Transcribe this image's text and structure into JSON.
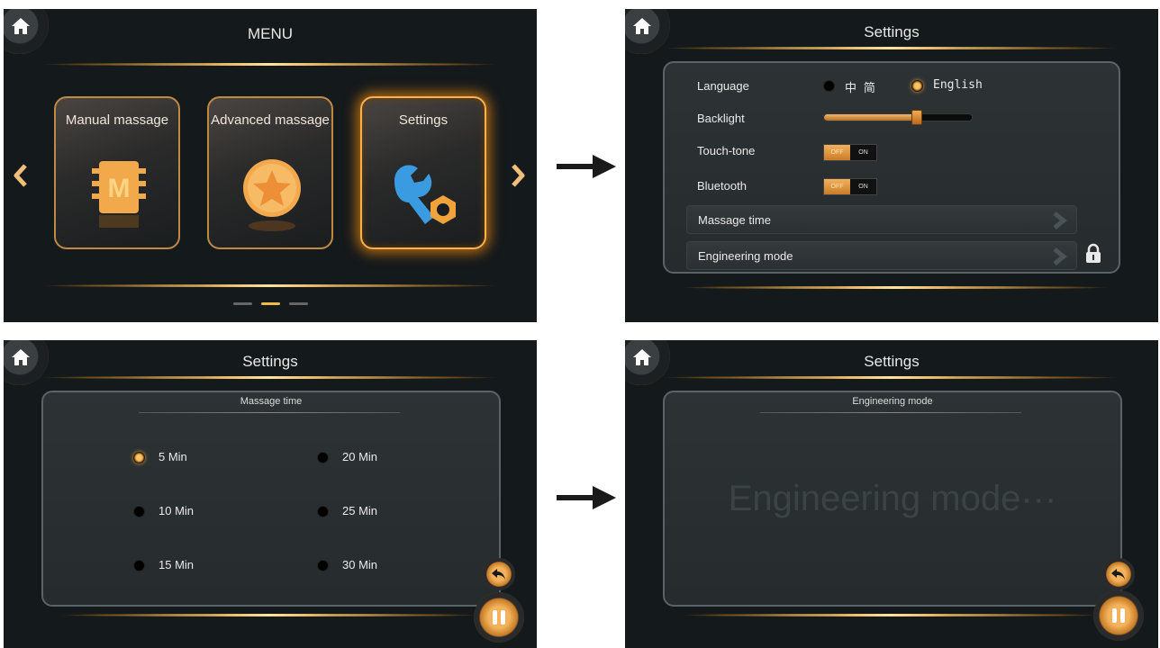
{
  "screen_menu": {
    "title": "MENU",
    "cards": [
      {
        "label": "Manual massage",
        "icon": "chip-m-icon"
      },
      {
        "label": "Advanced massage",
        "icon": "star-coin-icon"
      },
      {
        "label": "Settings",
        "icon": "wrench-nut-icon",
        "selected": true
      }
    ],
    "card_letter": "M",
    "page_indicator": {
      "count": 3,
      "active_index": 1
    }
  },
  "screen_settings": {
    "title": "Settings",
    "language_label": "Language",
    "language_options": [
      "中 简",
      "English"
    ],
    "language_selected": "English",
    "backlight_label": "Backlight",
    "backlight_level": 0.62,
    "touch_tone_label": "Touch-tone",
    "bluetooth_label": "Bluetooth",
    "toggle_off": "OFF",
    "toggle_on": "ON",
    "massage_time_label": "Massage time",
    "engineering_label": "Engineering mode"
  },
  "screen_massage_time": {
    "title": "Settings",
    "subtitle": "Massage time",
    "options": [
      "5 Min",
      "10 Min",
      "15 Min",
      "20 Min",
      "25 Min",
      "30 Min"
    ],
    "selected": "5 Min"
  },
  "screen_engineering": {
    "title": "Settings",
    "subtitle": "Engineering mode",
    "placeholder": "Engineering mode···"
  },
  "colors": {
    "accent": "#f0a842",
    "background": "#14191b",
    "panel": "#2b3133"
  }
}
